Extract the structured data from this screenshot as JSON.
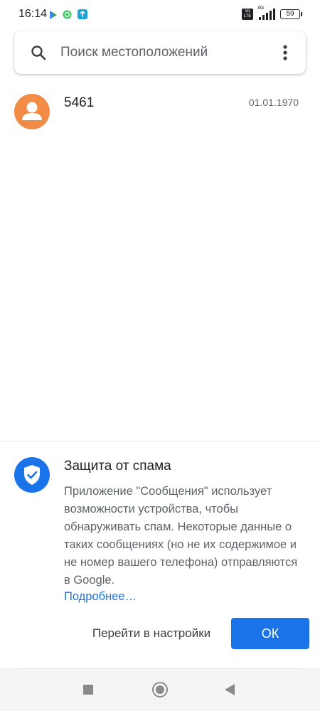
{
  "status_bar": {
    "time": "16:14",
    "volte_label": "Vo LTE",
    "network": "4G",
    "battery": "59",
    "left_icons": [
      "play-store-icon",
      "vpn-icon",
      "upload-icon"
    ]
  },
  "search": {
    "placeholder": "Поиск местоположений",
    "icon": "search-icon",
    "menu_icon": "more-vert-icon"
  },
  "conversations": [
    {
      "name": "5461",
      "date": "01.01.1970",
      "avatar_color": "#f28b45",
      "avatar_icon": "person-icon"
    }
  ],
  "spam_card": {
    "title": "Защита от спама",
    "body": "Приложение \"Сообщения\" использует возможности устройства, чтобы обнаруживать спам. Некоторые данные о таких сообщениях (но не их содержимое и не номер вашего телефона) отправляются в Google.",
    "learn_more": "Подробнее…",
    "settings_button": "Перейти в настройки",
    "ok_button": "ОК",
    "icon": "shield-check-icon"
  },
  "nav_bar": {
    "buttons": [
      "recents-icon",
      "home-icon",
      "back-icon"
    ]
  },
  "colors": {
    "accent": "#1a73e8",
    "avatar": "#f28b45",
    "text_primary": "#202124",
    "text_secondary": "#5f6368"
  }
}
